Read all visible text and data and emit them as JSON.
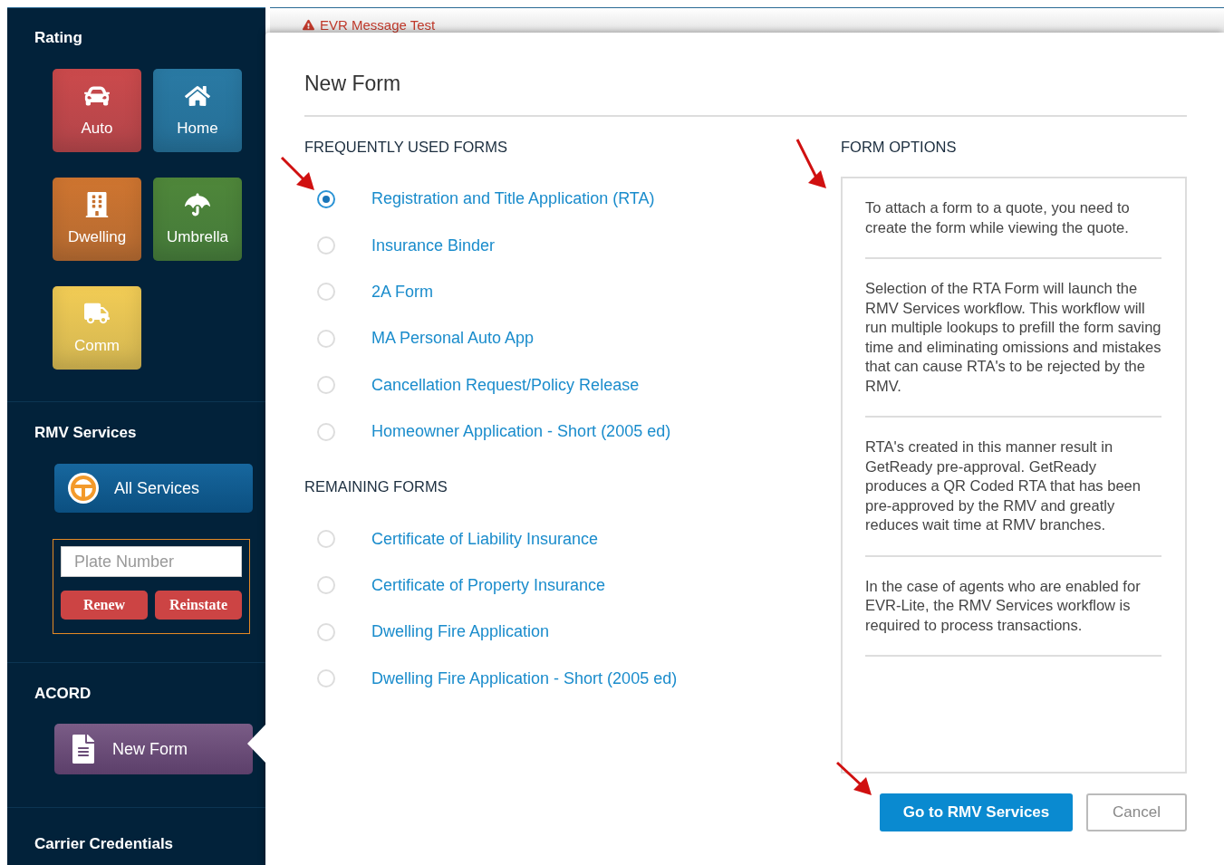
{
  "sidebar": {
    "sections": [
      {
        "kind": "tiles",
        "title": "Rating",
        "tiles": [
          {
            "label": "Auto",
            "kind": "car",
            "color": "#cc4a4c"
          },
          {
            "label": "Home",
            "kind": "house",
            "color": "#2a7aa4"
          },
          {
            "label": "Dwelling",
            "kind": "building",
            "color": "#cf7530"
          },
          {
            "label": "Umbrella",
            "kind": "umbrella",
            "color": "#4f873a"
          },
          {
            "label": "Comm",
            "kind": "truck",
            "color": "#f2cc55"
          }
        ]
      },
      {
        "kind": "rmv",
        "title": "RMV Services",
        "button": "All Services",
        "placeholder": "Plate Number",
        "actions": [
          "Renew",
          "Reinstate"
        ]
      },
      {
        "kind": "acord",
        "title": "ACORD",
        "button": "New Form",
        "selected": true
      },
      {
        "kind": "heading",
        "title": "Carrier Credentials"
      }
    ]
  },
  "banner": {
    "text": "EVR Message Test"
  },
  "modal": {
    "title": "New Form",
    "groups": [
      {
        "heading": "FREQUENTLY USED FORMS",
        "forms": [
          {
            "label": "Registration and Title Application (RTA)",
            "selected": true
          },
          {
            "label": "Insurance Binder",
            "selected": false
          },
          {
            "label": "2A Form",
            "selected": false
          },
          {
            "label": "MA Personal Auto App",
            "selected": false
          },
          {
            "label": "Cancellation Request/Policy Release",
            "selected": false
          },
          {
            "label": "Homeowner Application - Short (2005 ed)",
            "selected": false
          }
        ]
      },
      {
        "heading": "REMAINING FORMS",
        "forms": [
          {
            "label": "Certificate of Liability Insurance",
            "selected": false
          },
          {
            "label": "Certificate of Property Insurance",
            "selected": false
          },
          {
            "label": "Dwelling Fire Application",
            "selected": false
          },
          {
            "label": "Dwelling Fire Application - Short (2005 ed)",
            "selected": false
          }
        ]
      }
    ],
    "options": {
      "heading": "FORM OPTIONS",
      "paragraphs": [
        "To attach a form to a quote, you need to create the form while viewing the quote.",
        "Selection of the RTA Form will launch the RMV Services workflow. This workflow will run multiple lookups to prefill the form saving time and eliminating omissions and mistakes that can cause RTA's to be rejected by the RMV.",
        "RTA's created in this manner result in GetReady pre-approval. GetReady produces a QR Coded RTA that has been pre-approved by the RMV and greatly reduces wait time at RMV branches.",
        "In the case of agents who are enabled for EVR-Lite, the RMV Services workflow is required to process transactions."
      ]
    },
    "buttons": [
      {
        "label": "Go to RMV Services",
        "kind": "primary"
      },
      {
        "label": "Cancel",
        "kind": "secondary"
      }
    ]
  }
}
